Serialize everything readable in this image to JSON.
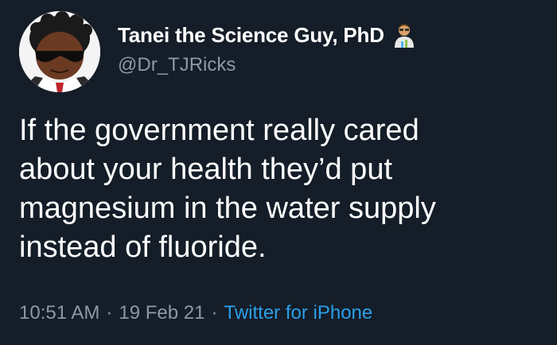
{
  "tweet": {
    "author": {
      "display_name": "Tanei the Science Guy, PhD",
      "handle": "@Dr_TJRicks",
      "badge_emoji": "scientist-emoji-icon"
    },
    "text_lines": [
      "If the government really cared",
      "about your health they’d put",
      "magnesium in the water supply",
      "instead of fluoride."
    ],
    "time": "10:51 AM",
    "separator": "·",
    "date": "19 Feb 21",
    "source": "Twitter for iPhone"
  },
  "colors": {
    "background": "#141d28",
    "text": "#ffffff",
    "muted": "#8a99a8",
    "link": "#2a9fe8"
  }
}
